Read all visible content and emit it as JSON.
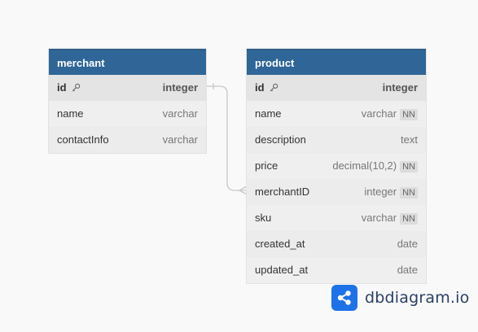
{
  "tables": {
    "merchant": {
      "name": "merchant",
      "columns": [
        {
          "name": "id",
          "type": "integer",
          "pk": true
        },
        {
          "name": "name",
          "type": "varchar"
        },
        {
          "name": "contactInfo",
          "type": "varchar"
        }
      ]
    },
    "product": {
      "name": "product",
      "columns": [
        {
          "name": "id",
          "type": "integer",
          "pk": true
        },
        {
          "name": "name",
          "type": "varchar",
          "badge": "NN"
        },
        {
          "name": "description",
          "type": "text"
        },
        {
          "name": "price",
          "type": "decimal(10,2)",
          "badge": "NN"
        },
        {
          "name": "merchantID",
          "type": "integer",
          "badge": "NN"
        },
        {
          "name": "sku",
          "type": "varchar",
          "badge": "NN"
        },
        {
          "name": "created_at",
          "type": "date"
        },
        {
          "name": "updated_at",
          "type": "date"
        }
      ]
    }
  },
  "relation": {
    "from": "merchant.id",
    "to": "product.merchantID",
    "from_cardinality": "one",
    "to_cardinality": "many"
  },
  "brand": {
    "name": "dbdiagram.io"
  },
  "colors": {
    "header": "#2f6697",
    "brand": "#1d72e8",
    "connector": "#c8c8c8"
  }
}
